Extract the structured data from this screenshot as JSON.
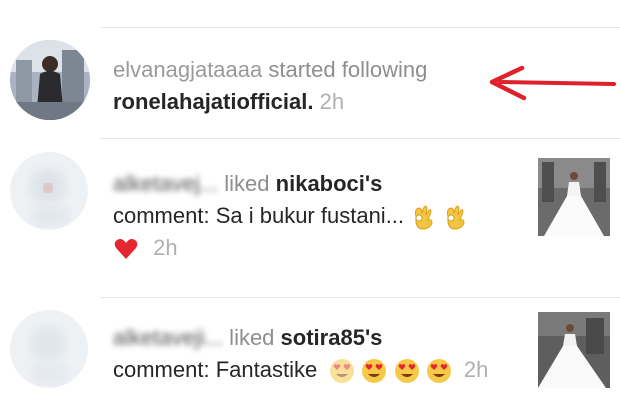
{
  "activity": [
    {
      "username": "elvanagjataaaa",
      "action": " started following",
      "target": "ronelahajatiofficial.",
      "time": "2h"
    },
    {
      "username": "alketavej...",
      "action": " liked ",
      "target": "nikaboci",
      "suffix": "'s",
      "comment_prefix": "comment: ",
      "comment": "Sa i bukur fustani...",
      "time": "2h"
    },
    {
      "username": "alketaveji...",
      "action": " liked ",
      "target": "sotira85",
      "suffix": "'s",
      "comment_prefix": "comment: ",
      "comment": "Fantastike",
      "time": "2h"
    }
  ],
  "colors": {
    "arrow": "#e0202a",
    "text_gray": "#8e8e8e",
    "bold_text": "#262626",
    "divider": "#e6e6e6"
  },
  "icons": [
    "red-arrow-icon",
    "ok-hand-icon",
    "red-heart-icon",
    "heart-eyes-icon"
  ]
}
